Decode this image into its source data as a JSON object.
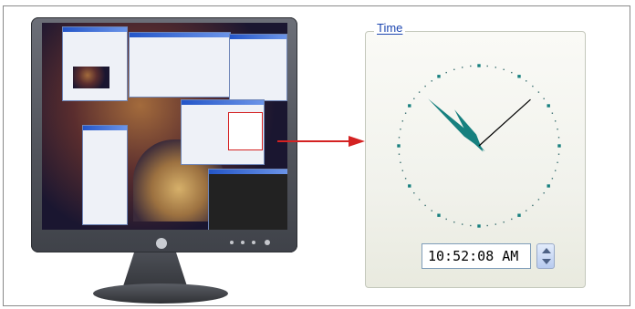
{
  "time_group": {
    "legend": "Time",
    "mnemonic": "T",
    "time_value": "10:52:08 AM"
  },
  "clock": {
    "hours": 10,
    "minutes": 52,
    "seconds": 8,
    "hand_color": "#17807f",
    "second_hand_color": "#000000",
    "marker_color": "#17807f"
  },
  "spinner": {
    "up_icon": "chevron-up-icon",
    "down_icon": "chevron-down-icon"
  },
  "illustration": {
    "arrow_color": "#d42222",
    "monitor_icon": "monitor-icon"
  }
}
